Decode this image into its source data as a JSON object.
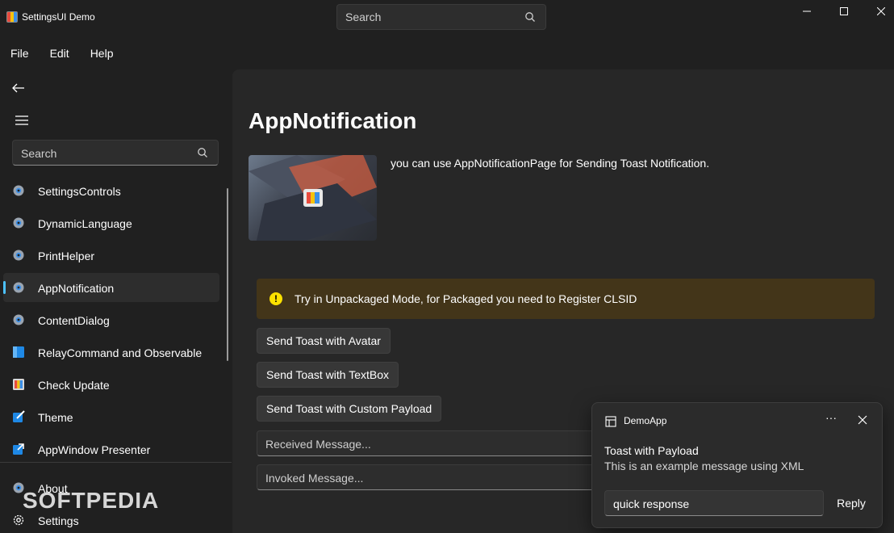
{
  "window": {
    "title": "SettingsUI Demo",
    "search_placeholder": "Search"
  },
  "menu": [
    "File",
    "Edit",
    "Help"
  ],
  "sidebar": {
    "search_placeholder": "Search",
    "items": [
      {
        "label": "SettingsControls",
        "icon": "gear-icon"
      },
      {
        "label": "DynamicLanguage",
        "icon": "gear-icon"
      },
      {
        "label": "PrintHelper",
        "icon": "gear-icon"
      },
      {
        "label": "AppNotification",
        "icon": "gear-icon",
        "selected": true
      },
      {
        "label": "ContentDialog",
        "icon": "gear-icon"
      },
      {
        "label": "RelayCommand and Observable",
        "icon": "blue-window-icon"
      },
      {
        "label": "Check Update",
        "icon": "app-color-icon"
      },
      {
        "label": "Theme",
        "icon": "theme-pen-icon"
      },
      {
        "label": "AppWindow Presenter",
        "icon": "presenter-icon"
      }
    ],
    "footer": [
      {
        "label": "About",
        "icon": "gear-icon"
      },
      {
        "label": "Settings",
        "icon": "settings-outline-icon"
      }
    ]
  },
  "watermark": "SOFTPEDIA",
  "page": {
    "title": "AppNotification",
    "description": "you can use AppNotificationPage for Sending Toast Notification.",
    "info": "Try in Unpackaged Mode, for Packaged you need to Register CLSID",
    "buttons": [
      "Send Toast with Avatar",
      "Send Toast with TextBox",
      "Send Toast with Custom Payload"
    ],
    "received_placeholder": "Received Message...",
    "invoked_placeholder": "Invoked Message..."
  },
  "toast": {
    "app": "DemoApp",
    "more": "···",
    "title": "Toast with Payload",
    "body": "This is an example message using XML",
    "input_value": "quick response",
    "reply": "Reply"
  },
  "colors": {
    "accent": "#4cc2ff",
    "info_bg": "#433519",
    "warning": "#fce100"
  }
}
